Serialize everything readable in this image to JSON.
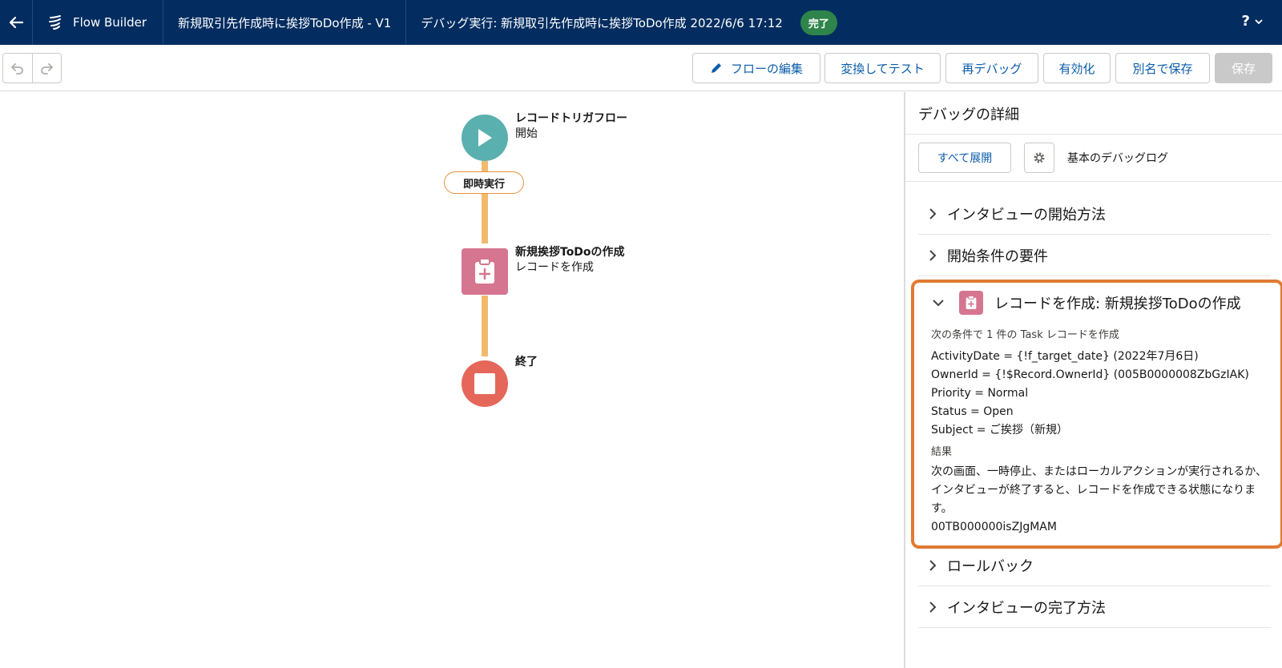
{
  "topbar": {
    "brand": "Flow Builder",
    "flow_name": "新規取引先作成時に挨拶ToDo作成 - V1",
    "debug_title": "デバッグ実行: 新規取引先作成時に挨拶ToDo作成 2022/6/6 17:12",
    "status_badge": "完了",
    "help_label": "?"
  },
  "toolbar": {
    "edit_flow": "フローの編集",
    "convert_test": "変換してテスト",
    "re_debug": "再デバッグ",
    "activate": "有効化",
    "save_as": "別名で保存",
    "save": "保存"
  },
  "canvas": {
    "start_node": {
      "title": "レコードトリガフロー",
      "subtitle": "開始"
    },
    "path_label": "即時実行",
    "create_node": {
      "title": "新規挨拶ToDoの作成",
      "subtitle": "レコードを作成"
    },
    "end_node": {
      "title": "終了"
    }
  },
  "panel": {
    "title": "デバッグの詳細",
    "expand_all": "すべて展開",
    "log_label": "基本のデバッグログ",
    "sections": [
      {
        "label": "インタビューの開始方法"
      },
      {
        "label": "開始条件の要件"
      },
      {
        "label": "ロールバック"
      },
      {
        "label": "インタビューの完了方法"
      }
    ],
    "expanded": {
      "title": "レコードを作成: 新規挨拶ToDoの作成",
      "condition": "次の条件で 1 件の Task レコードを作成",
      "fields": [
        "ActivityDate = {!f_target_date} (2022年7月6日)",
        "OwnerId = {!$Record.OwnerId} (005B0000008ZbGzIAK)",
        "Priority = Normal",
        "Status = Open",
        "Subject = ご挨拶（新規）"
      ],
      "result_label": "結果",
      "result_text": "次の画面、一時停止、またはローカルアクションが実行されるか、インタビューが終了すると、レコードを作成できる状態になります。",
      "record_id": "00TB000000isZJgMAM"
    }
  },
  "colors": {
    "topbar": "#032d60",
    "start": "#5ab0ae",
    "create": "#d6758f",
    "end": "#e5675a",
    "connector": "#f2b96d",
    "highlight": "#e07a32",
    "badge": "#2e844a"
  }
}
